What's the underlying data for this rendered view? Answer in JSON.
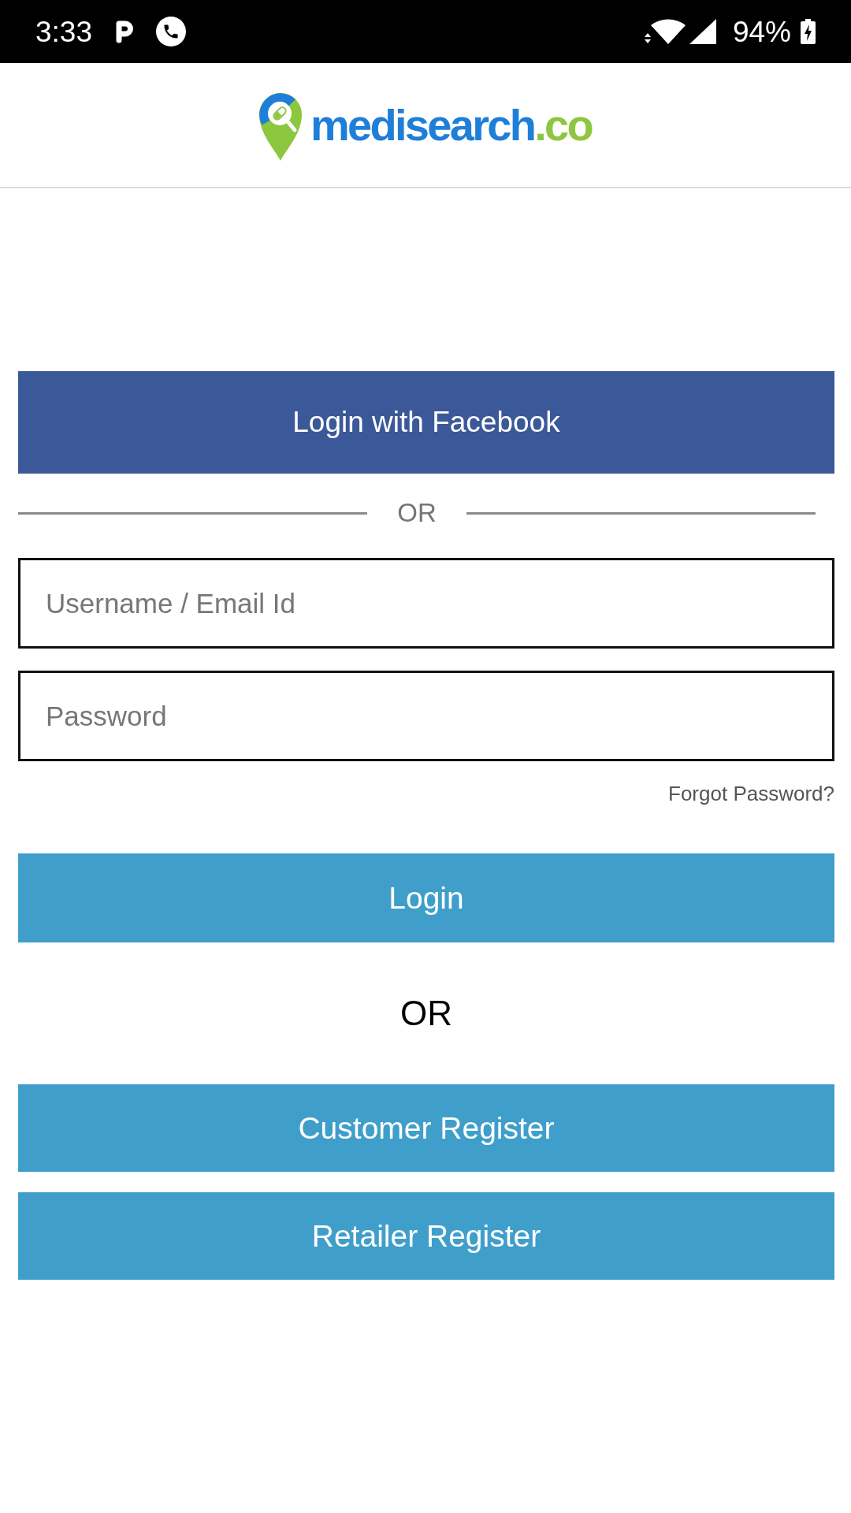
{
  "status_bar": {
    "time": "3:33",
    "battery": "94%"
  },
  "header": {
    "logo": {
      "name": "medisearch",
      "domain": ".co"
    }
  },
  "facebook_button": "Login with Facebook",
  "divider_label": "OR",
  "fields": [
    {
      "placeholder": "Username / Email Id"
    },
    {
      "placeholder": "Password"
    }
  ],
  "forgot_password_link": "Forgot Password?",
  "login_button": "Login",
  "separator_label": "OR",
  "register_buttons": [
    "Customer Register",
    "Retailer Register"
  ]
}
